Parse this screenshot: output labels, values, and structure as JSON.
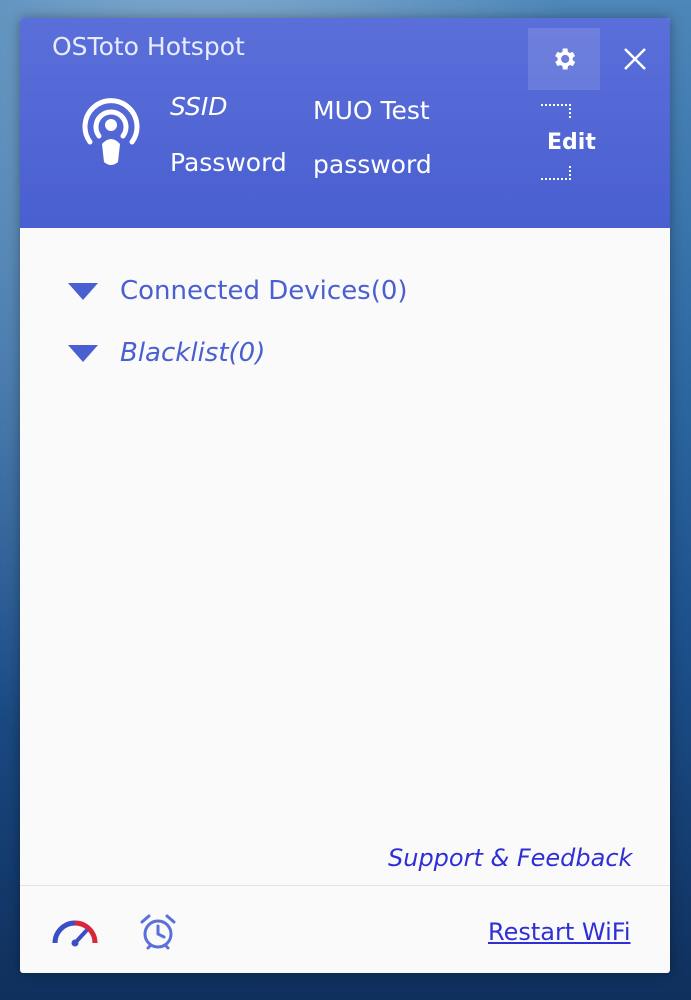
{
  "window": {
    "title": "OSToto Hotspot",
    "accent_color": "#4a5fd0"
  },
  "header": {
    "icon": "hotspot-icon",
    "ssid_label": "SSID",
    "ssid_value": "MUO Test",
    "password_label": "Password",
    "password_value": "password",
    "edit_label": "Edit",
    "settings_icon": "gear-icon",
    "close_icon": "close-icon"
  },
  "devices": {
    "connected_label": "Connected Devices(0)",
    "blacklist_label": "Blacklist(0)"
  },
  "footer": {
    "support_label": "Support & Feedback",
    "restart_label": "Restart WiFi",
    "speed_icon": "speedometer-icon",
    "alarm_icon": "alarm-clock-icon"
  }
}
